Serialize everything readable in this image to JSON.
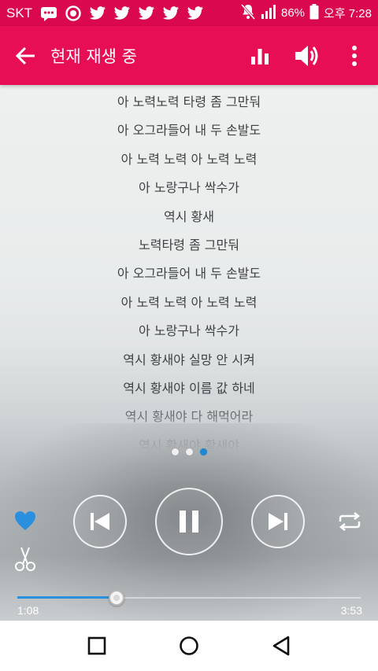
{
  "status_bar": {
    "carrier": "SKT",
    "battery": "86%",
    "time": "오후 7:28",
    "icons": [
      "message-icon",
      "target-icon",
      "twitter-icon",
      "twitter-icon",
      "twitter-icon",
      "twitter-icon",
      "twitter-icon"
    ]
  },
  "app_bar": {
    "title": "현재 재생 중"
  },
  "lyrics": [
    "아 노력노력 타령 좀 그만둬",
    "아 오그라들어 내 두 손발도",
    "아 노력 노력 아 노력 노력",
    "아 노랑구나 싹수가",
    "역시 황새",
    "노력타령 좀 그만둬",
    "아 오그라들어 내 두 손발도",
    "아 노력 노력 아 노력 노력",
    "아 노랑구나 싹수가",
    "역시 황새야 실망 안 시켜",
    "역시 황새야 이름 값 하네",
    "역시 황새야 다 해먹어라",
    "역시 황새야 황새야"
  ],
  "pager": {
    "count": 3,
    "active": 2
  },
  "playback": {
    "current_time": "1:08",
    "total_time": "3:53",
    "progress": 0.29,
    "favorited": true,
    "playing": true
  },
  "colors": {
    "status_bar": "#d9084f",
    "app_bar": "#e80e56",
    "accent": "#2a8fdc"
  }
}
